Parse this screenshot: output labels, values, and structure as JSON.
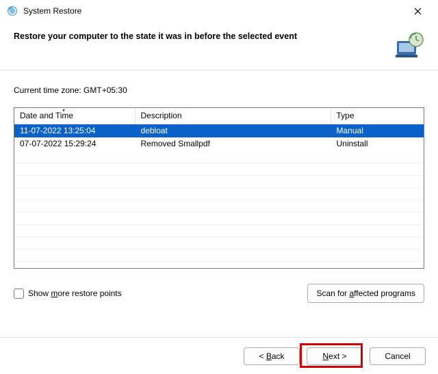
{
  "window": {
    "title": "System Restore"
  },
  "header": {
    "heading": "Restore your computer to the state it was in before the selected event"
  },
  "timezone_label": "Current time zone: GMT+05:30",
  "table": {
    "columns": {
      "date": "Date and Time",
      "description": "Description",
      "type": "Type"
    },
    "rows": [
      {
        "date": "11-07-2022 13:25:04",
        "description": "debloat",
        "type": "Manual",
        "selected": true
      },
      {
        "date": "07-07-2022 15:29:24",
        "description": "Removed Smallpdf",
        "type": "Uninstall",
        "selected": false
      }
    ]
  },
  "show_more": {
    "prefix": "Show ",
    "accel": "m",
    "suffix": "ore restore points"
  },
  "scan_btn": {
    "prefix": "Scan for ",
    "accel": "a",
    "suffix": "ffected programs"
  },
  "buttons": {
    "back": {
      "lt": "< ",
      "accel": "B",
      "suffix": "ack"
    },
    "next": {
      "accel": "N",
      "suffix": "ext >"
    },
    "cancel": "Cancel"
  }
}
